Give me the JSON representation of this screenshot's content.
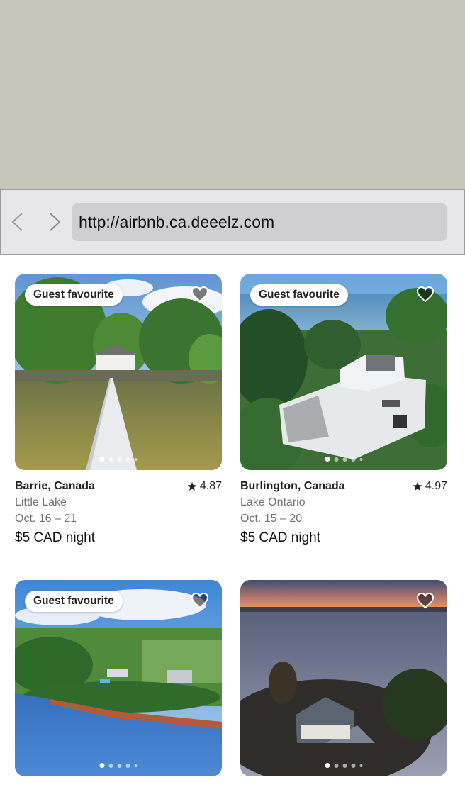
{
  "browser": {
    "back_icon": "chevron-left-icon",
    "forward_icon": "chevron-right-icon",
    "url": "http://airbnb.ca.deeelz.com"
  },
  "listings": [
    {
      "badge": "Guest favourite",
      "location": "Barrie, Canada",
      "rating": "4.87",
      "subtitle": "Little Lake",
      "dates": "Oct. 16 – 21",
      "price": "$5 CAD night",
      "photo_dots": 5,
      "active_dot": 0
    },
    {
      "badge": "Guest favourite",
      "location": "Burlington, Canada",
      "rating": "4.97",
      "subtitle": "Lake Ontario",
      "dates": "Oct. 15 – 20",
      "price": "$5 CAD night",
      "photo_dots": 5,
      "active_dot": 0
    },
    {
      "badge": "Guest favourite",
      "photo_dots": 5,
      "active_dot": 0
    },
    {
      "photo_dots": 5,
      "active_dot": 0
    }
  ]
}
